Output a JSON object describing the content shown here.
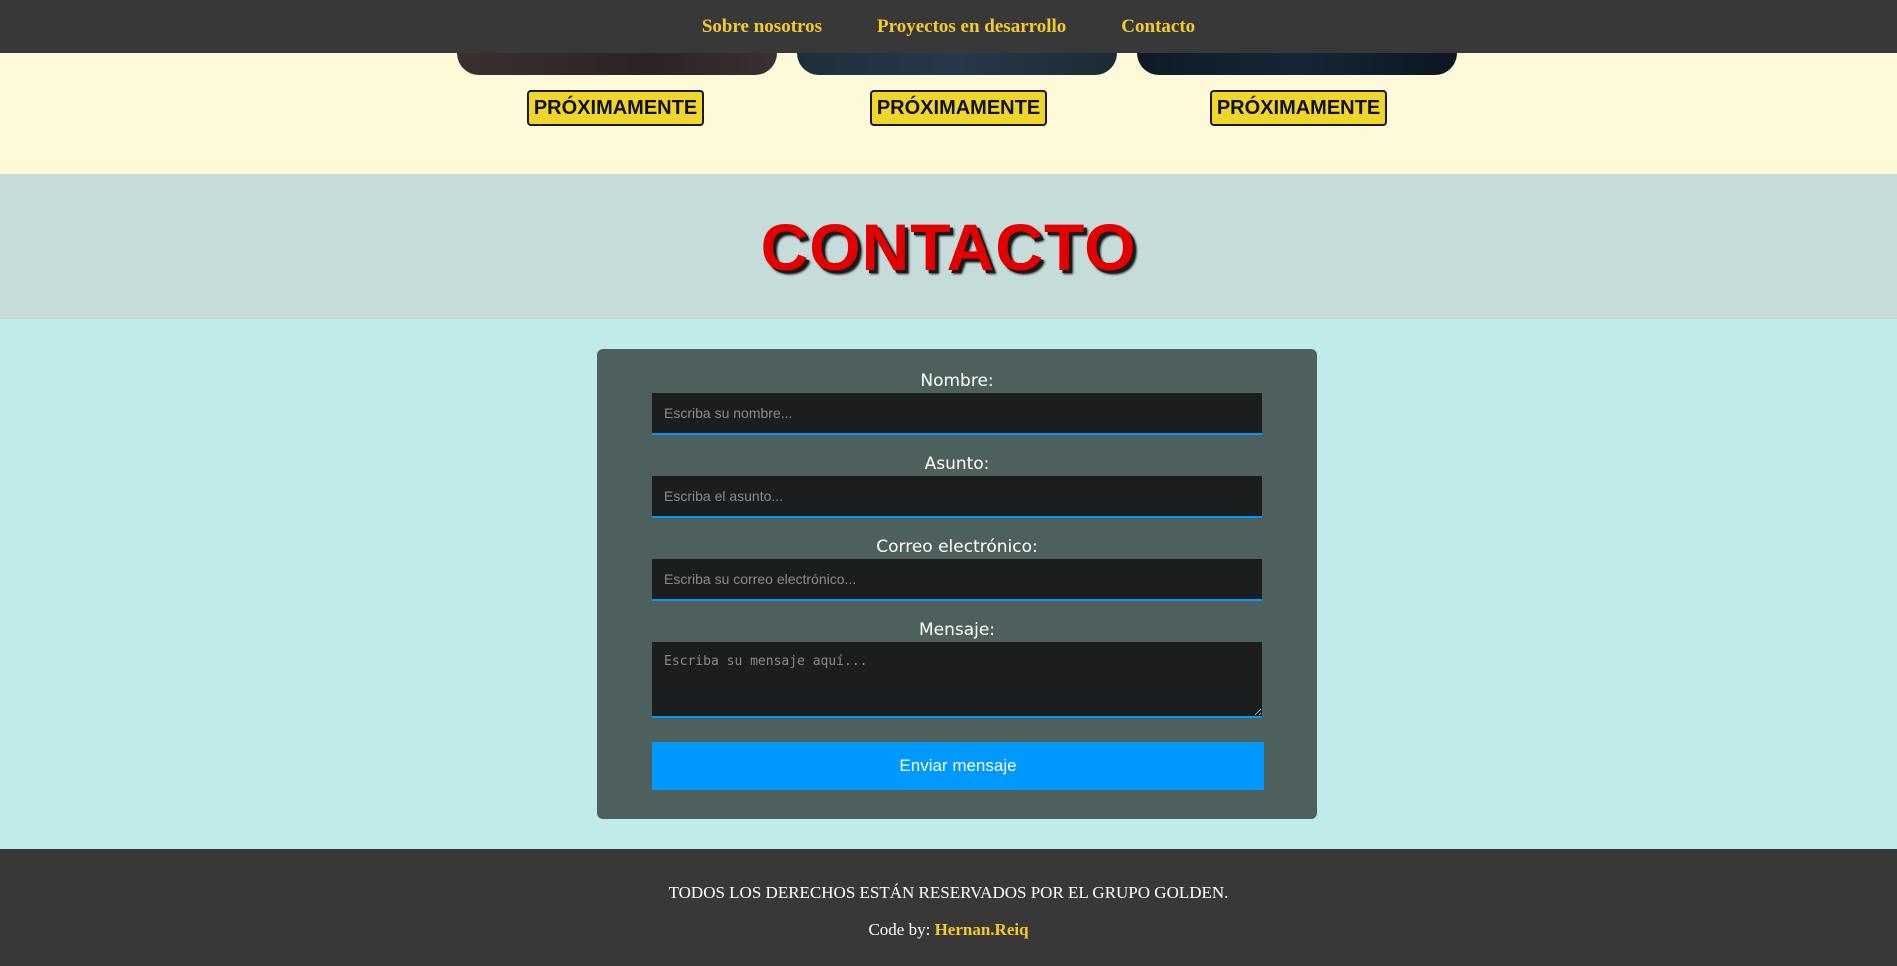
{
  "nav": {
    "items": [
      {
        "label": "Sobre nosotros"
      },
      {
        "label": "Proyectos en desarrollo"
      },
      {
        "label": "Contacto"
      }
    ]
  },
  "projects": {
    "cards": [
      {
        "button_label": "PRÓXIMAMENTE"
      },
      {
        "button_label": "PRÓXIMAMENTE"
      },
      {
        "button_label": "PRÓXIMAMENTE"
      }
    ]
  },
  "contact": {
    "title": "CONTACTO",
    "form": {
      "name_label": "Nombre:",
      "name_placeholder": "Escriba su nombre...",
      "subject_label": "Asunto:",
      "subject_placeholder": "Escriba el asunto...",
      "email_label": "Correo electrónico:",
      "email_placeholder": "Escriba su correo electrónico...",
      "message_label": "Mensaje:",
      "message_placeholder": "Escriba su mensaje aquí...",
      "submit_label": "Enviar mensaje"
    }
  },
  "footer": {
    "rights": "TODOS LOS DERECHOS ESTÁN RESERVADOS POR EL GRUPO GOLDEN.",
    "credit_prefix": "Code by:",
    "credit_author": "Hernan.Reiq"
  },
  "colors": {
    "nav_bg": "#383838",
    "nav_link": "#f2cc2a",
    "projects_bg": "#fef9d8",
    "badge_bg": "#f0d52a",
    "contact_band_bg": "#c6dcdb",
    "title_color": "#e30000",
    "page_bg": "#bfeceb",
    "form_bg": "#4d605d",
    "input_bg": "#1c1d1f",
    "accent": "#0099ff"
  }
}
